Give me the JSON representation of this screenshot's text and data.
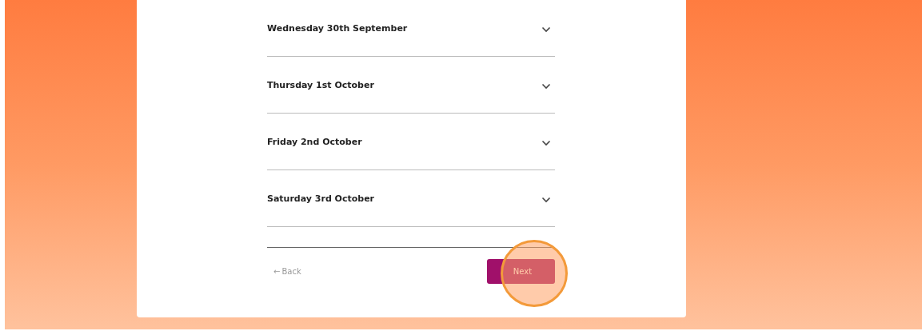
{
  "days": [
    {
      "label": "Wednesday 30th September",
      "expanded": false
    },
    {
      "label": "Thursday 1st October",
      "expanded": false
    },
    {
      "label": "Friday 2nd October",
      "expanded": false
    },
    {
      "label": "Saturday 3rd October",
      "expanded": false
    }
  ],
  "back": {
    "icon": "←",
    "label": "Back"
  },
  "next": {
    "label": "Next",
    "highlighted": true
  }
}
